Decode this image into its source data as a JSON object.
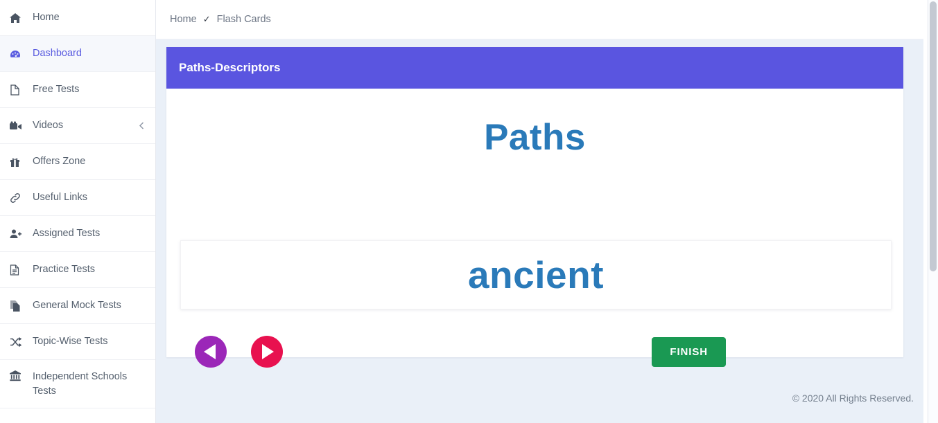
{
  "sidebar": {
    "items": [
      {
        "label": "Home",
        "icon": "home-icon",
        "active": false,
        "chevron": false
      },
      {
        "label": "Dashboard",
        "icon": "dashboard-icon",
        "active": true,
        "chevron": false
      },
      {
        "label": "Free Tests",
        "icon": "file-icon",
        "active": false,
        "chevron": false
      },
      {
        "label": "Videos",
        "icon": "video-camera-icon",
        "active": false,
        "chevron": true
      },
      {
        "label": "Offers Zone",
        "icon": "gift-icon",
        "active": false,
        "chevron": false
      },
      {
        "label": "Useful Links",
        "icon": "link-icon",
        "active": false,
        "chevron": false
      },
      {
        "label": "Assigned Tests",
        "icon": "user-plus-icon",
        "active": false,
        "chevron": false
      },
      {
        "label": "Practice Tests",
        "icon": "document-icon",
        "active": false,
        "chevron": false
      },
      {
        "label": "General Mock Tests",
        "icon": "copy-icon",
        "active": false,
        "chevron": false
      },
      {
        "label": "Topic-Wise Tests",
        "icon": "shuffle-icon",
        "active": false,
        "chevron": false
      },
      {
        "label": "Independent Schools Tests",
        "icon": "bank-icon",
        "active": false,
        "chevron": false
      }
    ]
  },
  "breadcrumb": {
    "home": "Home",
    "separator": "✓",
    "current": "Flash Cards"
  },
  "card": {
    "header_title": "Paths-Descriptors",
    "term": "Paths",
    "word": "ancient"
  },
  "controls": {
    "prev_label": "previous-card",
    "next_label": "next-card",
    "finish_label": "FINISH"
  },
  "footer": {
    "copyright": "© 2020 All Rights Reserved."
  },
  "colors": {
    "header_purple": "#5a55e0",
    "term_blue": "#2a7ab9",
    "prev_purple": "#9b27b8",
    "next_pink": "#e8114f",
    "finish_green": "#1a9953",
    "active_indigo": "#5a5ce0",
    "page_bg": "#eaf0f8"
  }
}
